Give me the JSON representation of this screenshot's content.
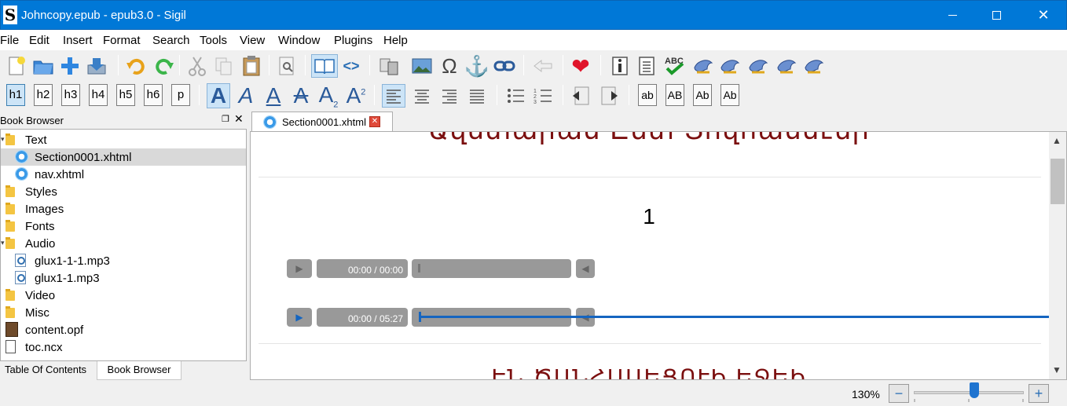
{
  "window": {
    "title": "Johncopy.epub - epub3.0 - Sigil",
    "app_icon_glyph": "S",
    "minimize": "—",
    "close": "✕"
  },
  "menu": [
    "File",
    "Edit",
    "Insert",
    "Format",
    "Search",
    "Tools",
    "View",
    "Window",
    "Plugins",
    "Help"
  ],
  "toolbar1": {
    "icons": [
      "new-file-icon",
      "open-folder-icon",
      "add-file-icon",
      "save-icon",
      "undo-icon",
      "redo-icon",
      "cut-icon",
      "copy-icon",
      "paste-icon",
      "find-in-page-icon",
      "book-view-icon",
      "code-view-icon",
      "split-view-icon",
      "insert-image-icon",
      "insert-special-char-icon",
      "insert-anchor-icon",
      "insert-link-icon",
      "back-arrow-icon",
      "donate-heart-icon",
      "metadata-info-icon",
      "table-of-contents-icon",
      "spellcheck-icon",
      "plugin-1-icon",
      "plugin-2-icon",
      "plugin-3-icon",
      "plugin-4-icon",
      "plugin-5-icon"
    ],
    "glyphs": {
      "omega": "Ω",
      "anchor": "⚓",
      "code": "<>",
      "heart": "❤",
      "info": "i",
      "abc": "ABC"
    }
  },
  "toolbar2": {
    "headings": [
      "h1",
      "h2",
      "h3",
      "h4",
      "h5",
      "h6",
      "p"
    ],
    "active_heading": "h1",
    "format_glyphs": [
      "A",
      "A",
      "A",
      "A",
      "A",
      "A"
    ],
    "format_sub": "2",
    "format_sup": "2",
    "case_buttons": [
      "ab",
      "AB",
      "Ab",
      "Ab"
    ]
  },
  "book_browser": {
    "title": "Book Browser",
    "float_glyph": "❐",
    "close_glyph": "✕",
    "tree": [
      {
        "label": "Text",
        "type": "folder",
        "expanded": true,
        "indent": 0
      },
      {
        "label": "Section0001.xhtml",
        "type": "xhtml",
        "indent": 1,
        "selected": true
      },
      {
        "label": "nav.xhtml",
        "type": "xhtml",
        "indent": 1
      },
      {
        "label": "Styles",
        "type": "folder",
        "indent": 0
      },
      {
        "label": "Images",
        "type": "folder",
        "indent": 0
      },
      {
        "label": "Fonts",
        "type": "folder",
        "indent": 0
      },
      {
        "label": "Audio",
        "type": "folder",
        "expanded": true,
        "indent": 0
      },
      {
        "label": "glux1-1-1.mp3",
        "type": "audio",
        "indent": 1
      },
      {
        "label": "glux1-1.mp3",
        "type": "audio",
        "indent": 1
      },
      {
        "label": "Video",
        "type": "folder",
        "indent": 0
      },
      {
        "label": "Misc",
        "type": "folder",
        "indent": 0
      },
      {
        "label": "content.opf",
        "type": "opf",
        "indent": 0
      },
      {
        "label": "toc.ncx",
        "type": "ncx",
        "indent": 0
      }
    ]
  },
  "bottom_tabs": {
    "toc": "Table Of Contents",
    "book_browser": "Book Browser",
    "active": "Book Browser"
  },
  "editor": {
    "tab_label": "Section0001.xhtml",
    "tab_close": "✕",
    "heading_top": "Ավետարան Ըստ Յովհաննէսի",
    "chapter_number": "1",
    "heading_bottom": "ԷՆ ԾԱՆՀԱԱԵՑՈՒԻ ԵՋԵԻ",
    "players": [
      {
        "time": "00:00 / 00:00",
        "enabled": false,
        "progress": 0
      },
      {
        "time": "00:00 / 05:27",
        "enabled": true,
        "progress": 0
      }
    ],
    "play_glyph": "▶",
    "volume_glyph": "◀"
  },
  "scrollbar": {
    "up": "▲",
    "down": "▼"
  },
  "status": {
    "zoom_label": "130%",
    "zoom_out": "−",
    "zoom_in": "+",
    "zoom_value": 0.55
  },
  "colors": {
    "title_bar": "#0078d7",
    "heading_text": "#7b0f0f",
    "player_accent": "#1565c0"
  }
}
